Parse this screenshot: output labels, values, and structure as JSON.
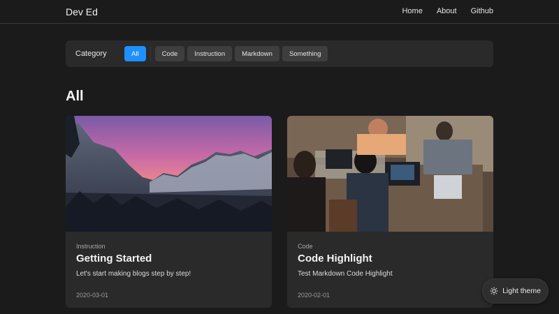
{
  "nav": {
    "brand": "Dev Ed",
    "links": [
      "Home",
      "About",
      "Github"
    ]
  },
  "categories": {
    "label": "Category",
    "items": [
      "All",
      "Code",
      "Instruction",
      "Markdown",
      "Something"
    ],
    "selected": "All",
    "accent": "#1e90ff"
  },
  "heading": "All",
  "posts": [
    {
      "category": "Instruction",
      "title": "Getting Started",
      "description": "Let's start making blogs step by step!",
      "date": "2020-03-01",
      "image": "mountain-sunset-photo"
    },
    {
      "category": "Code",
      "title": "Code Highlight",
      "description": "Test Markdown Code Highlight",
      "date": "2020-02-01",
      "image": "people-working-laptops-photo"
    }
  ],
  "theme_toggle": {
    "label": "Light theme",
    "icon": "sun-icon"
  }
}
